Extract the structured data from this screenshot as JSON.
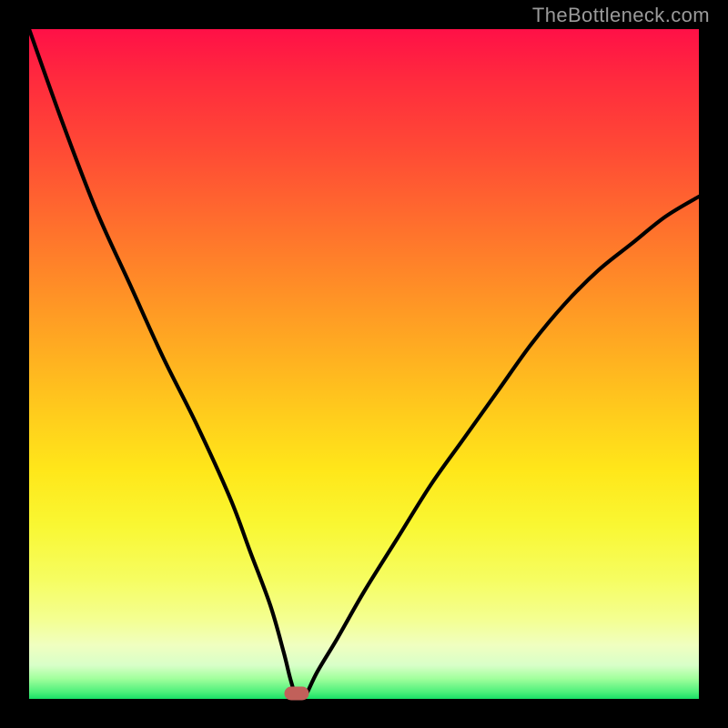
{
  "watermark": "TheBottleneck.com",
  "marker": {
    "x_pct": 40,
    "y_pct": 99.2
  },
  "colors": {
    "curve_stroke": "#000000",
    "marker_fill": "#c1605a",
    "frame_bg": "#000000"
  },
  "chart_data": {
    "type": "line",
    "title": "",
    "xlabel": "",
    "ylabel": "",
    "xlim": [
      0,
      100
    ],
    "ylim": [
      0,
      100
    ],
    "annotations": [],
    "series": [
      {
        "name": "bottleneck-curve",
        "x": [
          0,
          5,
          10,
          15,
          20,
          25,
          30,
          33,
          36,
          38,
          39,
          40,
          41,
          43,
          46,
          50,
          55,
          60,
          65,
          70,
          75,
          80,
          85,
          90,
          95,
          100
        ],
        "y": [
          100,
          86,
          73,
          62,
          51,
          41,
          30,
          22,
          14,
          7,
          3,
          0,
          0,
          4,
          9,
          16,
          24,
          32,
          39,
          46,
          53,
          59,
          64,
          68,
          72,
          75
        ]
      }
    ],
    "marker_point": {
      "x": 40,
      "y": 0
    }
  }
}
